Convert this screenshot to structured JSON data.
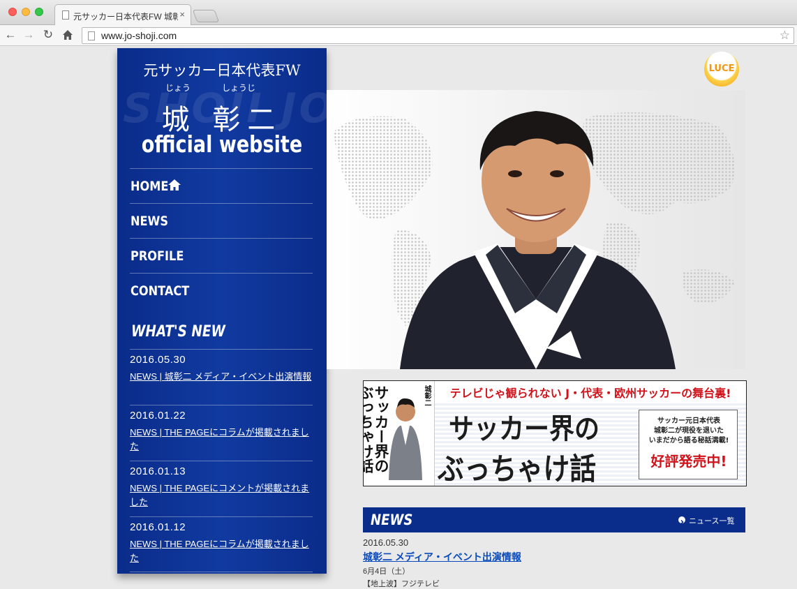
{
  "browser": {
    "tab_title": "元サッカー日本代表FW 城彰",
    "tab_close": "×",
    "url": "www.jo-shoji.com"
  },
  "sidebar": {
    "tagline": "元サッカー日本代表FW",
    "reading_surname": "じょう",
    "reading_given": "しょうじ",
    "name": "城 彰二",
    "subtitle": "official website",
    "watermark": "SHOJI JO",
    "nav": [
      {
        "label": "HOME",
        "icon": "home-icon"
      },
      {
        "label": "NEWS"
      },
      {
        "label": "PROFILE"
      },
      {
        "label": "CONTACT"
      }
    ],
    "whats_new_title": "WHAT'S NEW",
    "whats_new": [
      {
        "date": "2016.05.30",
        "title": "NEWS | 城彰二 メディア・イベント出演情報"
      },
      {
        "date": "2016.01.22",
        "title": "NEWS | THE PAGEにコラムが掲載されました"
      },
      {
        "date": "2016.01.13",
        "title": "NEWS | THE PAGEにコメントが掲載されました"
      },
      {
        "date": "2016.01.12",
        "title": "NEWS | THE PAGEにコラムが掲載されました"
      }
    ]
  },
  "logo": {
    "text": "LUCE"
  },
  "banner": {
    "catch": "テレビじゃ観られない J・代表・欧州サッカーの舞台裏!",
    "book_title": "サッカー界のぶっちゃけ話",
    "book_author": "城彰二",
    "title_line1": "サッカー界の",
    "title_line2": "ぶっちゃけ話",
    "box_line1": "サッカー元日本代表",
    "box_line2": "城彰二が現役を退いた",
    "box_line3": "いまだから語る秘話満載!",
    "box_cta": "好評発売中!"
  },
  "news_section": {
    "title": "NEWS",
    "more_label": "ニュース一覧",
    "post": {
      "date": "2016.05.30",
      "title": "城彰二 メディア・イベント出演情報",
      "line1": "6月4日（土）",
      "line2": "【地上波】フジテレビ"
    }
  },
  "colors": {
    "sidebar_blue": "#0a2c8a",
    "banner_red": "#d0121b",
    "link_blue": "#0a4bbb",
    "luce_orange": "#f29611"
  }
}
